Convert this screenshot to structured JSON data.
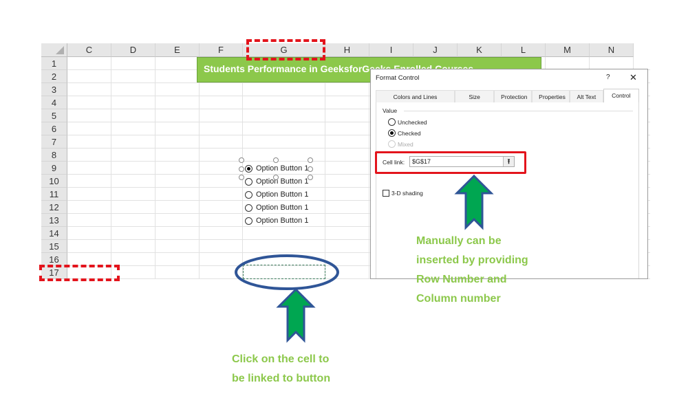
{
  "sheet": {
    "columns": [
      "C",
      "D",
      "E",
      "F",
      "G",
      "H",
      "I",
      "J",
      "K",
      "L",
      "M",
      "N"
    ],
    "rows": [
      "1",
      "2",
      "3",
      "4",
      "5",
      "6",
      "7",
      "8",
      "9",
      "10",
      "11",
      "12",
      "13",
      "14",
      "15",
      "16",
      "17"
    ],
    "banner": "Students Performance in GeeksforGeeks Enrolled Courses",
    "option_buttons": [
      {
        "label": "Option Button 1",
        "checked": true
      },
      {
        "label": "Option Button 1",
        "checked": false
      },
      {
        "label": "Option Button 1",
        "checked": false
      },
      {
        "label": "Option Button 1",
        "checked": false
      },
      {
        "label": "Option Button 1",
        "checked": false
      }
    ]
  },
  "dialog": {
    "title": "Format Control",
    "help": "?",
    "close": "✕",
    "tabs": [
      "Colors and Lines",
      "Size",
      "Protection",
      "Properties",
      "Alt Text",
      "Control"
    ],
    "active_tab": "Control",
    "value_group": "Value",
    "unchecked": "Unchecked",
    "checked": "Checked",
    "mixed": "Mixed",
    "cell_link_label": "Cell link:",
    "cell_link_value": "$G$17",
    "collapse_icon": "⭱",
    "shading": "3-D shading"
  },
  "annotations": {
    "right": [
      "Manually can be",
      "inserted by providing",
      "Row Number and",
      "Column number"
    ],
    "bottom": [
      "Click on the cell to",
      "be linked to button"
    ],
    "colors": {
      "green_text": "#8cc84b",
      "arrow_fill": "#00a651",
      "arrow_stroke": "#2f5597",
      "red": "#e3141c"
    }
  }
}
